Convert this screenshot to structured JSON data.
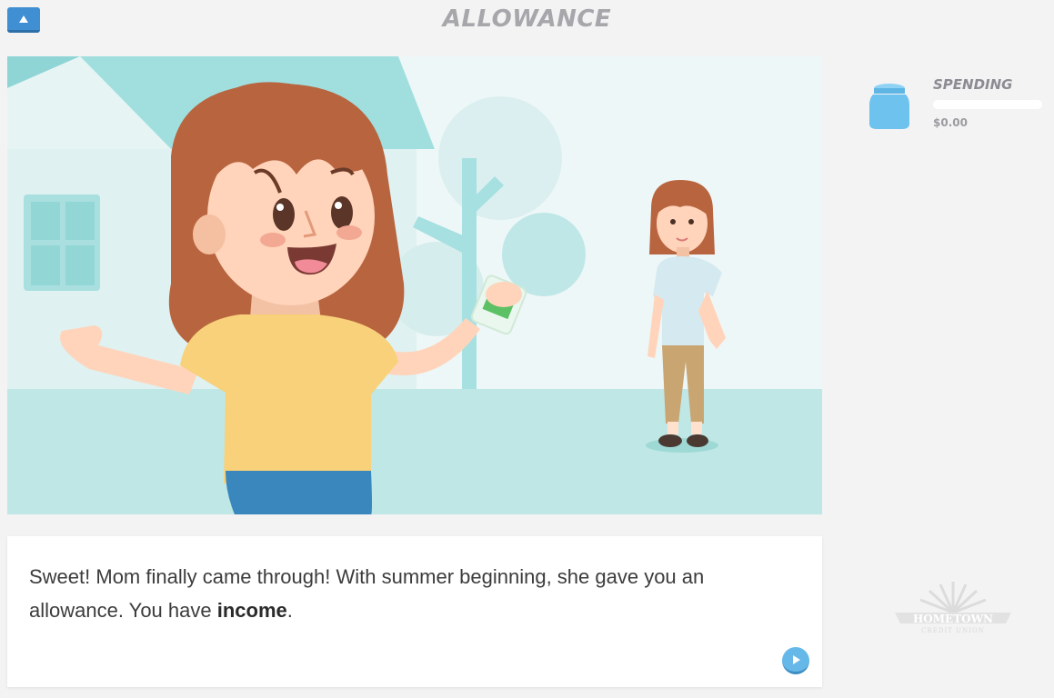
{
  "header": {
    "title": "ALLOWANCE",
    "menu_icon": "caret-up-icon"
  },
  "sidebar": {
    "jar_icon": "spending-jar-icon",
    "label": "SPENDING",
    "amount": "$0.00",
    "progress": 0
  },
  "dialog": {
    "text_before": "Sweet! Mom finally came through! With summer beginning, she gave you an allowance. You have ",
    "bold_word": "income",
    "text_after": ".",
    "next_icon": "play-icon"
  },
  "logo": {
    "line1": "HOMETOWN",
    "line2": "CREDIT UNION"
  },
  "colors": {
    "accent_blue": "#3f8fd2",
    "jar_blue": "#6dc3ee",
    "title_gray": "#a6a6ab",
    "scene_teal": "#a1dfdf"
  }
}
